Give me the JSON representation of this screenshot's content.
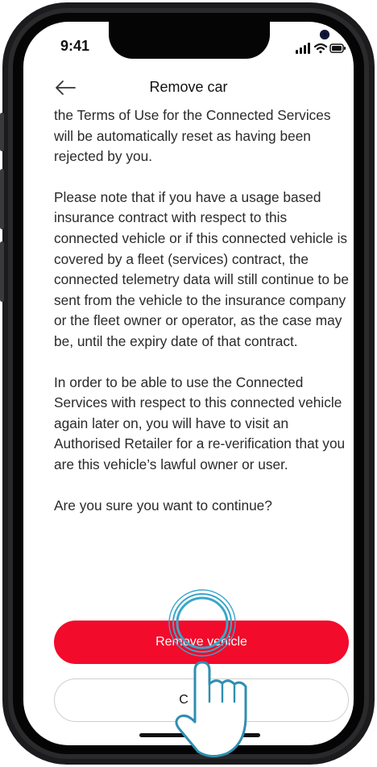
{
  "status_bar": {
    "time": "9:41"
  },
  "header": {
    "title": "Remove car"
  },
  "body": {
    "paragraphs": [
      "the Terms of Use for the Connected Services will be automatically reset as having been rejected by you.",
      "Please note that if you have a usage based insurance contract with respect to this connected vehicle or if this connected vehicle is covered by a fleet (services) contract, the connected telemetry data will still continue to be sent from the vehicle to the insurance company or the fleet owner or operator, as the case may be, until the expiry date of that contract.",
      "In order to be able to use the Connected Services with respect to this connected vehicle again later on, you will have to visit an Authorised Retailer for a re-verification that you are this vehicle’s lawful owner or user.",
      "Are you sure you want to continue?"
    ]
  },
  "actions": {
    "primary_label": "Remove vehicle",
    "secondary_label": "C"
  },
  "colors": {
    "accent": "#f20b2b",
    "touch_highlight": "#3aa6c9"
  },
  "icons": {
    "back": "arrow-left-icon",
    "touch": "pointing-hand-icon"
  }
}
